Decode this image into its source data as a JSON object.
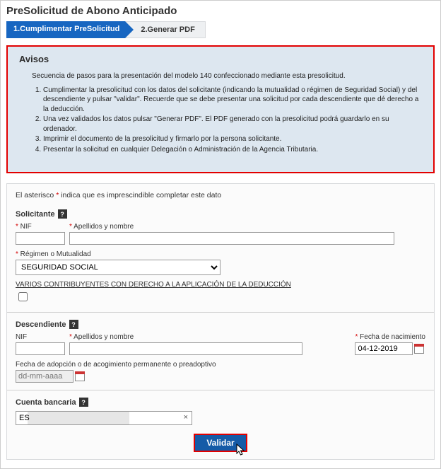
{
  "title": "PreSolicitud de Abono Anticipado",
  "wizard": {
    "step1": "1.Cumplimentar PreSolicitud",
    "step2": "2.Generar PDF"
  },
  "avisos": {
    "heading": "Avisos",
    "intro": "Secuencia de pasos para la presentación del modelo 140 confeccionado mediante esta presolicitud.",
    "step1": "Cumplimentar la presolicitud con los datos del solicitante (indicando la mutualidad o régimen de Seguridad Social) y del descendiente y pulsar \"validar\". Recuerde que se debe presentar una solicitud por cada descendiente que dé derecho a la deducción.",
    "step2": "Una vez validados los datos pulsar \"Generar PDF\". El PDF generado con la presolicitud podrá guardarlo en su ordenador.",
    "step3": "Imprimir el documento de la presolicitud y firmarlo por la persona solicitante.",
    "step4": "Presentar la solicitud en cualquier Delegación o Administración de la Agencia Tributaria."
  },
  "note": {
    "prefix": "El asterisco ",
    "suffix": " indica que es imprescindible completar este dato"
  },
  "solicitante": {
    "heading": "Solicitante",
    "nif_label": "NIF",
    "apellidos_label": "Apellidos y nombre",
    "regimen_label": "Régimen o Mutualidad",
    "regimen_value": "SEGURIDAD SOCIAL",
    "varios_text": "VARIOS CONTRIBUYENTES CON DERECHO A LA APLICACIÓN DE LA DEDUCCIÓN"
  },
  "descendiente": {
    "heading": "Descendiente",
    "nif_label": "NIF",
    "apellidos_label": "Apellidos y nombre",
    "fecha_nac_label": "Fecha de nacimiento",
    "fecha_nac_value": "04-12-2019",
    "fecha_adop_label": "Fecha de adopción o de acogimiento permanente o preadoptivo",
    "fecha_adop_placeholder": "dd-mm-aaaa"
  },
  "cuenta": {
    "heading": "Cuenta bancaria",
    "iban_prefix": "ES"
  },
  "validar_button": "Validar"
}
